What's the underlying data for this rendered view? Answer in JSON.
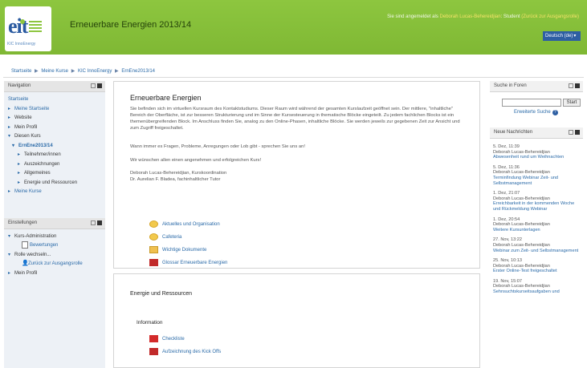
{
  "header": {
    "logo_text": "eit",
    "logo_sub": "KIC InnoEnergy",
    "site_title": "Erneuerbare Energien 2013/14",
    "login_prefix": "Sie sind angemeldet als",
    "user_name": "Deborah Lucas-Behereidjian",
    "role_text": ": Student",
    "return_link": "(Zurück zur Ausgangsrolle)",
    "language": "Deutsch (de)"
  },
  "breadcrumb": [
    "Startseite",
    "▶",
    "Meine Kurse",
    "▶",
    "KIC InnoEnergy",
    "▶",
    "ErnEne2013/14"
  ],
  "navigation": {
    "title": "Navigation",
    "items": [
      {
        "label": "Startseite",
        "arrow": ""
      },
      {
        "label": "Meine Startseite",
        "arrow": "▸"
      },
      {
        "label": "Website",
        "arrow": "▸"
      },
      {
        "label": "Mein Profil",
        "arrow": "▸"
      },
      {
        "label": "Diesen Kurs",
        "arrow": "▾"
      },
      {
        "label": "ErnEne2013/14",
        "arrow": "▾"
      },
      {
        "label": "Teilnehmer/innen",
        "arrow": "▸"
      },
      {
        "label": "Auszeichnungen",
        "arrow": "▸"
      },
      {
        "label": "Allgemeines",
        "arrow": "▸"
      },
      {
        "label": "Energie und Ressourcen",
        "arrow": "▸"
      },
      {
        "label": "Meine Kurse",
        "arrow": "▸"
      }
    ]
  },
  "settings": {
    "title": "Einstellungen",
    "items": [
      {
        "label": "Kurs-Administration",
        "arrow": "▾"
      },
      {
        "label": "Bewertungen",
        "arrow": ""
      },
      {
        "label": "Rolle wechseln...",
        "arrow": "▾"
      },
      {
        "label": "Zurück zur Ausgangsrolle",
        "arrow": ""
      },
      {
        "label": "Mein Profil",
        "arrow": "▸"
      }
    ]
  },
  "intro": {
    "title": "Erneuerbare Energien",
    "p1": "Sie befinden sich im virtuellen Kursraum des Kontaktstudiums. Dieser Raum wird während der gesamten Kurslaufzeit geöffnet sein. Der mittlere, \"inhaltliche\" Bereich der Oberfläche, ist zur besseren Strukturierung und im Sinne der Kursesteuerung in thematische Blöcke eingeteilt. Zu jedem fachlichen Blocks ist ein themenübergreifenden Block. Im Anschluss finden Sie, analog zu den Online-Phasen, inhaltliche Blöcke. Sie werden jeweils zur gegebenen Zeit zur Ansicht und zum Zugriff freigeschaltet.",
    "p2": "Wann immer es Fragen, Probleme, Anregungen oder Lob gibt - sprechen Sie uns an!",
    "p3": "Wir wünschen allen einen angenehmen und erfolgreichen Kurs!",
    "sig1": "Deborah Lucas-Behereidjian, Kurskoordination",
    "sig2": "Dr. Aurelian F. Bladea, fachinhaltlicher Tutor",
    "resources": [
      {
        "label": "Aktuelles und Organisation",
        "icon": "forum-icon"
      },
      {
        "label": "Cafeteria",
        "icon": "forum-icon"
      },
      {
        "label": "Wichtige Dokumente",
        "icon": "folder-icon"
      },
      {
        "label": "Glossar Erneuerbare Energien",
        "icon": "glossary-icon"
      }
    ]
  },
  "section2": {
    "title": "Energie und Ressourcen",
    "info_label": "Information",
    "resources": [
      {
        "label": "Checkliste",
        "icon": "pdf-icon"
      },
      {
        "label": "Aufzeichnung des Kick Offs",
        "icon": "recording-icon"
      }
    ]
  },
  "search": {
    "title": "Suche in Foren",
    "button": "Start",
    "advanced": "Erweiterte Suche"
  },
  "news": {
    "title": "Neue Nachrichten",
    "items": [
      {
        "date": "5. Dez, 11:39",
        "author": "Deborah Lucas-Behereidjian",
        "subject": "Abwesenheit rund um Weihnachten"
      },
      {
        "date": "5. Dez, 11:36",
        "author": "Deborah Lucas-Behereidjian",
        "subject": "Terminfindung Webinar Zeit- und Selbstmanagement"
      },
      {
        "date": "1. Dez, 21:07",
        "author": "Deborah Lucas-Behereidjian",
        "subject": "Erreichbarkeit in der kommenden Woche und Rückmeldung Webinar"
      },
      {
        "date": "1. Dez, 20:54",
        "author": "Deborah Lucas-Behereidjian",
        "subject": "Weitere Kursunterlagen"
      },
      {
        "date": "27. Nov, 13:22",
        "author": "Deborah Lucas-Behereidjian",
        "subject": "Webinar zum Zeit- und Selbstmanagement"
      },
      {
        "date": "25. Nov, 10:13",
        "author": "Deborah Lucas-Behereidjian",
        "subject": "Erster Online-Test freigeschaltet"
      },
      {
        "date": "19. Nov, 15:07",
        "author": "Deborah Lucas-Behereidjian",
        "subject": "Sehnsuchtskurseitsaufgaben und"
      }
    ]
  }
}
